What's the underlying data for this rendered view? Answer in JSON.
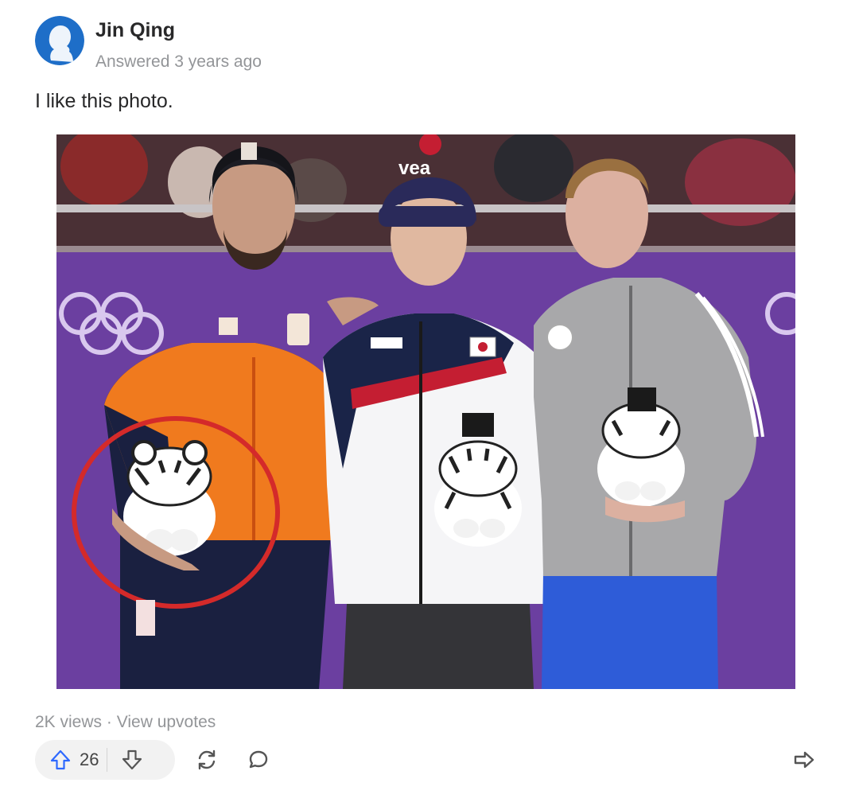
{
  "author": {
    "name": "Jin Qing",
    "meta": "Answered 3 years ago",
    "avatar_icon": "default-avatar-icon"
  },
  "answer": {
    "text": "I like this photo."
  },
  "photo": {
    "content": "three-athletes-on-podium-holding-tiger-mascots"
  },
  "stats": {
    "views": "2K views",
    "separator": "·",
    "view_upvotes": "View upvotes"
  },
  "actions": {
    "upvote_count": "26",
    "upvote_icon": "arrow-up-icon",
    "downvote_icon": "arrow-down-icon",
    "share_icon": "share-arrow-icon",
    "reshare_icon": "refresh-icon",
    "comment_icon": "speech-bubble-icon"
  },
  "colors": {
    "accent": "#2e69ff",
    "muted_text": "#939598",
    "primary_text": "#282829",
    "avatar_bg": "#1e6ec8"
  }
}
